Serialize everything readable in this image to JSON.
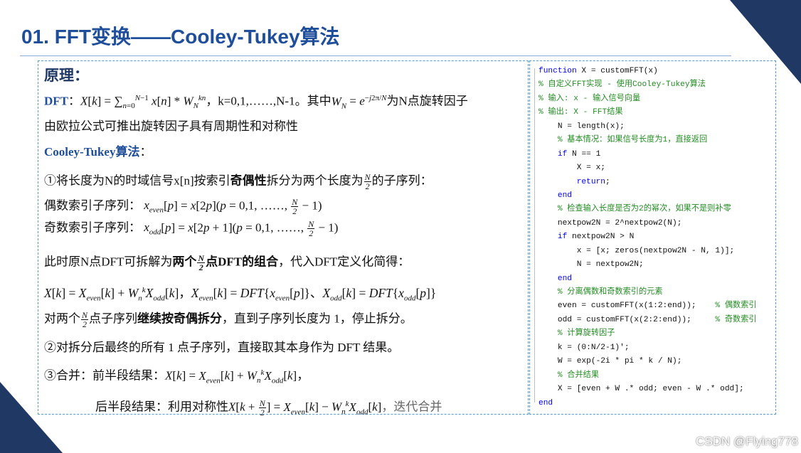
{
  "title": "01. FFT变换——Cooley-Tukey算法",
  "left": {
    "heading": "原理：",
    "dft_label": "DFT",
    "dft_tail": "，k=0,1,……,N-1。其中",
    "dft_tail2": "为N点旋转因子",
    "euler_line": "由欧拉公式可推出旋转因子具有周期性和对称性",
    "ct_heading": "Cooley-Tukey算法",
    "ct_colon": "：",
    "step1_a": "①将长度为N的时域信号x[n]按索引",
    "step1_bold": "奇偶性",
    "step1_b": "拆分为两个长度为",
    "step1_c": "的子序列：",
    "even_label": "偶数索引子序列：",
    "odd_label": "奇数索引子序列：",
    "decomp_a": "此时原N点DFT可拆解为",
    "decomp_bold1": "两个",
    "decomp_bold2": "点DFT的组合",
    "decomp_b": "，代入DFT定义化简得：",
    "recur_a": "对两个",
    "recur_b": "点子序列",
    "recur_bold": "继续按奇偶拆分",
    "recur_c": "，直到子序列长度为 1，停止拆分。",
    "step2": "②对拆分后最终的所有 1 点子序列，直接取其本身作为 DFT 结果。",
    "step3_label": "③合并：前半段结果：",
    "step3_back_label": "后半段结果：利用对称性",
    "step3_tail": "，迭代合并"
  },
  "code": {
    "lines": [
      {
        "kw": "function",
        "tx": " X = customFFT(x)",
        "cm": ""
      },
      {
        "kw": "",
        "tx": "",
        "cm": "% 自定义FFT实现 - 使用Cooley-Tukey算法"
      },
      {
        "kw": "",
        "tx": "",
        "cm": "% 输入: x - 输入信号向量"
      },
      {
        "kw": "",
        "tx": "",
        "cm": "% 输出: X - FFT结果"
      },
      {
        "kw": "",
        "tx": "    N = length(x);",
        "cm": ""
      },
      {
        "kw": "",
        "tx": "    ",
        "cm": "% 基本情况：如果信号长度为1，直接返回"
      },
      {
        "kw": "    if",
        "tx": " N == 1",
        "cm": ""
      },
      {
        "kw": "",
        "tx": "        X = x;",
        "cm": ""
      },
      {
        "kw": "        return",
        "tx": ";",
        "cm": ""
      },
      {
        "kw": "    end",
        "tx": "",
        "cm": ""
      },
      {
        "kw": "",
        "tx": "    ",
        "cm": "% 检查输入长度是否为2的幂次，如果不是则补零"
      },
      {
        "kw": "",
        "tx": "    nextpow2N = 2^nextpow2(N);",
        "cm": ""
      },
      {
        "kw": "    if",
        "tx": " nextpow2N > N",
        "cm": ""
      },
      {
        "kw": "",
        "tx": "        x = [x; zeros(nextpow2N - N, 1)];",
        "cm": ""
      },
      {
        "kw": "",
        "tx": "        N = nextpow2N;",
        "cm": ""
      },
      {
        "kw": "    end",
        "tx": "",
        "cm": ""
      },
      {
        "kw": "",
        "tx": "    ",
        "cm": "% 分离偶数和奇数索引的元素"
      },
      {
        "kw": "",
        "tx": "    even = customFFT(x(1:2:end));    ",
        "cm": "% 偶数索引"
      },
      {
        "kw": "",
        "tx": "    odd = customFFT(x(2:2:end));     ",
        "cm": "% 奇数索引"
      },
      {
        "kw": "",
        "tx": "    ",
        "cm": "% 计算旋转因子"
      },
      {
        "kw": "",
        "tx": "    k = (0:N/2-1)';",
        "cm": ""
      },
      {
        "kw": "",
        "tx": "    W = exp(-2i * pi * k / N);",
        "cm": ""
      },
      {
        "kw": "",
        "tx": "    ",
        "cm": "% 合并结果"
      },
      {
        "kw": "",
        "tx": "    X = [even + W .* odd; even - W .* odd];",
        "cm": ""
      },
      {
        "kw": "end",
        "tx": "",
        "cm": ""
      }
    ]
  },
  "watermark": "CSDN @Flying778"
}
